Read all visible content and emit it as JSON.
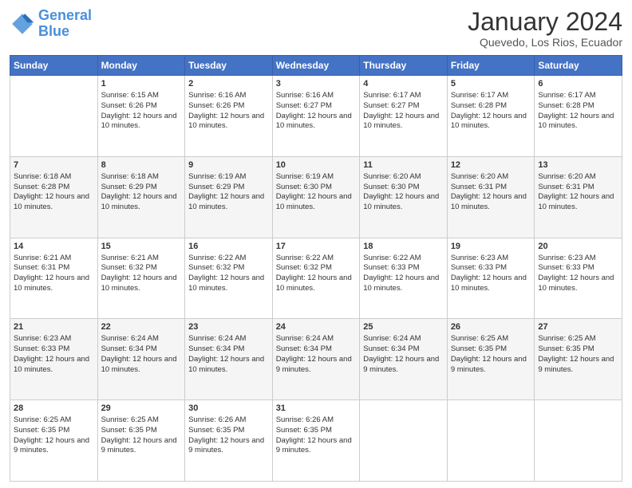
{
  "header": {
    "logo_line1": "General",
    "logo_line2": "Blue",
    "month_title": "January 2024",
    "location": "Quevedo, Los Rios, Ecuador"
  },
  "days_of_week": [
    "Sunday",
    "Monday",
    "Tuesday",
    "Wednesday",
    "Thursday",
    "Friday",
    "Saturday"
  ],
  "weeks": [
    [
      {
        "day": "",
        "sunrise": "",
        "sunset": "",
        "daylight": ""
      },
      {
        "day": "1",
        "sunrise": "Sunrise: 6:15 AM",
        "sunset": "Sunset: 6:26 PM",
        "daylight": "Daylight: 12 hours and 10 minutes."
      },
      {
        "day": "2",
        "sunrise": "Sunrise: 6:16 AM",
        "sunset": "Sunset: 6:26 PM",
        "daylight": "Daylight: 12 hours and 10 minutes."
      },
      {
        "day": "3",
        "sunrise": "Sunrise: 6:16 AM",
        "sunset": "Sunset: 6:27 PM",
        "daylight": "Daylight: 12 hours and 10 minutes."
      },
      {
        "day": "4",
        "sunrise": "Sunrise: 6:17 AM",
        "sunset": "Sunset: 6:27 PM",
        "daylight": "Daylight: 12 hours and 10 minutes."
      },
      {
        "day": "5",
        "sunrise": "Sunrise: 6:17 AM",
        "sunset": "Sunset: 6:28 PM",
        "daylight": "Daylight: 12 hours and 10 minutes."
      },
      {
        "day": "6",
        "sunrise": "Sunrise: 6:17 AM",
        "sunset": "Sunset: 6:28 PM",
        "daylight": "Daylight: 12 hours and 10 minutes."
      }
    ],
    [
      {
        "day": "7",
        "sunrise": "Sunrise: 6:18 AM",
        "sunset": "Sunset: 6:28 PM",
        "daylight": "Daylight: 12 hours and 10 minutes."
      },
      {
        "day": "8",
        "sunrise": "Sunrise: 6:18 AM",
        "sunset": "Sunset: 6:29 PM",
        "daylight": "Daylight: 12 hours and 10 minutes."
      },
      {
        "day": "9",
        "sunrise": "Sunrise: 6:19 AM",
        "sunset": "Sunset: 6:29 PM",
        "daylight": "Daylight: 12 hours and 10 minutes."
      },
      {
        "day": "10",
        "sunrise": "Sunrise: 6:19 AM",
        "sunset": "Sunset: 6:30 PM",
        "daylight": "Daylight: 12 hours and 10 minutes."
      },
      {
        "day": "11",
        "sunrise": "Sunrise: 6:20 AM",
        "sunset": "Sunset: 6:30 PM",
        "daylight": "Daylight: 12 hours and 10 minutes."
      },
      {
        "day": "12",
        "sunrise": "Sunrise: 6:20 AM",
        "sunset": "Sunset: 6:31 PM",
        "daylight": "Daylight: 12 hours and 10 minutes."
      },
      {
        "day": "13",
        "sunrise": "Sunrise: 6:20 AM",
        "sunset": "Sunset: 6:31 PM",
        "daylight": "Daylight: 12 hours and 10 minutes."
      }
    ],
    [
      {
        "day": "14",
        "sunrise": "Sunrise: 6:21 AM",
        "sunset": "Sunset: 6:31 PM",
        "daylight": "Daylight: 12 hours and 10 minutes."
      },
      {
        "day": "15",
        "sunrise": "Sunrise: 6:21 AM",
        "sunset": "Sunset: 6:32 PM",
        "daylight": "Daylight: 12 hours and 10 minutes."
      },
      {
        "day": "16",
        "sunrise": "Sunrise: 6:22 AM",
        "sunset": "Sunset: 6:32 PM",
        "daylight": "Daylight: 12 hours and 10 minutes."
      },
      {
        "day": "17",
        "sunrise": "Sunrise: 6:22 AM",
        "sunset": "Sunset: 6:32 PM",
        "daylight": "Daylight: 12 hours and 10 minutes."
      },
      {
        "day": "18",
        "sunrise": "Sunrise: 6:22 AM",
        "sunset": "Sunset: 6:33 PM",
        "daylight": "Daylight: 12 hours and 10 minutes."
      },
      {
        "day": "19",
        "sunrise": "Sunrise: 6:23 AM",
        "sunset": "Sunset: 6:33 PM",
        "daylight": "Daylight: 12 hours and 10 minutes."
      },
      {
        "day": "20",
        "sunrise": "Sunrise: 6:23 AM",
        "sunset": "Sunset: 6:33 PM",
        "daylight": "Daylight: 12 hours and 10 minutes."
      }
    ],
    [
      {
        "day": "21",
        "sunrise": "Sunrise: 6:23 AM",
        "sunset": "Sunset: 6:33 PM",
        "daylight": "Daylight: 12 hours and 10 minutes."
      },
      {
        "day": "22",
        "sunrise": "Sunrise: 6:24 AM",
        "sunset": "Sunset: 6:34 PM",
        "daylight": "Daylight: 12 hours and 10 minutes."
      },
      {
        "day": "23",
        "sunrise": "Sunrise: 6:24 AM",
        "sunset": "Sunset: 6:34 PM",
        "daylight": "Daylight: 12 hours and 10 minutes."
      },
      {
        "day": "24",
        "sunrise": "Sunrise: 6:24 AM",
        "sunset": "Sunset: 6:34 PM",
        "daylight": "Daylight: 12 hours and 9 minutes."
      },
      {
        "day": "25",
        "sunrise": "Sunrise: 6:24 AM",
        "sunset": "Sunset: 6:34 PM",
        "daylight": "Daylight: 12 hours and 9 minutes."
      },
      {
        "day": "26",
        "sunrise": "Sunrise: 6:25 AM",
        "sunset": "Sunset: 6:35 PM",
        "daylight": "Daylight: 12 hours and 9 minutes."
      },
      {
        "day": "27",
        "sunrise": "Sunrise: 6:25 AM",
        "sunset": "Sunset: 6:35 PM",
        "daylight": "Daylight: 12 hours and 9 minutes."
      }
    ],
    [
      {
        "day": "28",
        "sunrise": "Sunrise: 6:25 AM",
        "sunset": "Sunset: 6:35 PM",
        "daylight": "Daylight: 12 hours and 9 minutes."
      },
      {
        "day": "29",
        "sunrise": "Sunrise: 6:25 AM",
        "sunset": "Sunset: 6:35 PM",
        "daylight": "Daylight: 12 hours and 9 minutes."
      },
      {
        "day": "30",
        "sunrise": "Sunrise: 6:26 AM",
        "sunset": "Sunset: 6:35 PM",
        "daylight": "Daylight: 12 hours and 9 minutes."
      },
      {
        "day": "31",
        "sunrise": "Sunrise: 6:26 AM",
        "sunset": "Sunset: 6:35 PM",
        "daylight": "Daylight: 12 hours and 9 minutes."
      },
      {
        "day": "",
        "sunrise": "",
        "sunset": "",
        "daylight": ""
      },
      {
        "day": "",
        "sunrise": "",
        "sunset": "",
        "daylight": ""
      },
      {
        "day": "",
        "sunrise": "",
        "sunset": "",
        "daylight": ""
      }
    ]
  ]
}
